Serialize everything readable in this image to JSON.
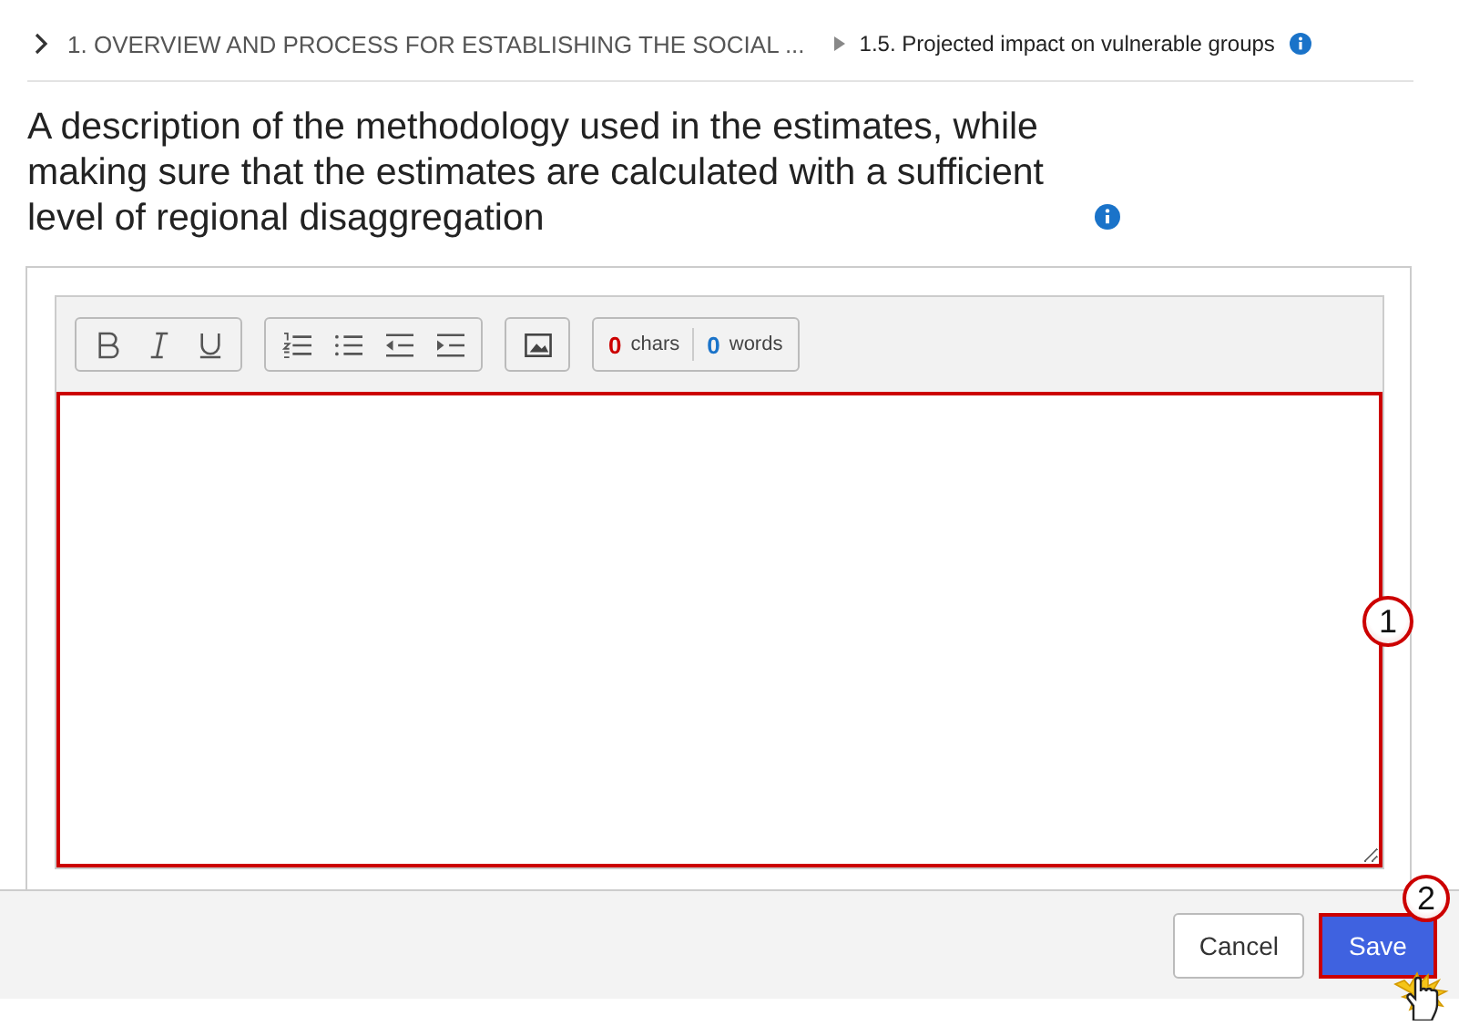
{
  "breadcrumb": [
    {
      "label": "1. OVERVIEW AND PROCESS FOR ESTABLISHING THE SOCIAL ...",
      "current": false
    },
    {
      "label": "1.5. Projected impact on vulnerable groups",
      "current": true
    }
  ],
  "question": "A description of the methodology used in the estimates, while making sure that the estimates are calculated with a sufficient level of regional disaggregation",
  "counter": {
    "chars": "0",
    "chars_label": "chars",
    "words": "0",
    "words_label": "words"
  },
  "callouts": [
    {
      "number": "1"
    },
    {
      "number": "2"
    }
  ],
  "buttons": [
    {
      "label": "Cancel",
      "kind": "secondary"
    },
    {
      "label": "Save",
      "kind": "primary"
    }
  ]
}
